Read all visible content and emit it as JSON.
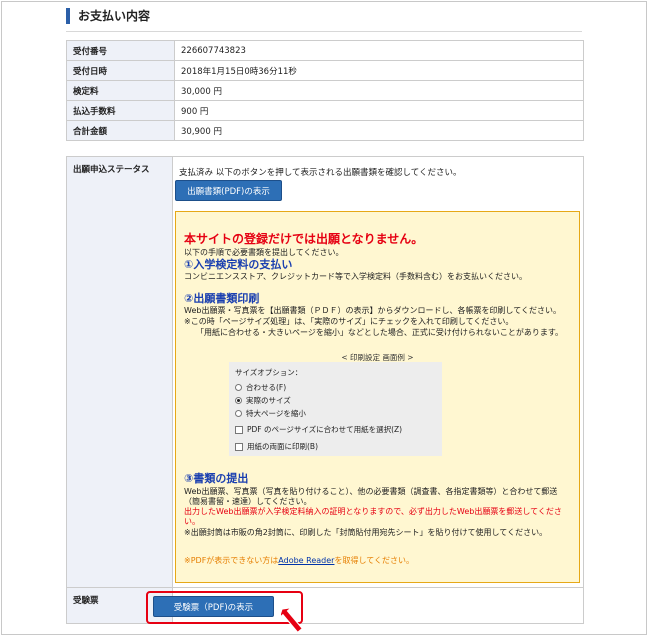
{
  "section": {
    "title": "お支払い内容"
  },
  "summary_rows": [
    {
      "label": "受付番号",
      "value": "226607743823"
    },
    {
      "label": "受付日時",
      "value": "2018年1月15日0時36分11秒"
    },
    {
      "label": "検定料",
      "value": "30,000 円"
    },
    {
      "label": "払込手数料",
      "value": "900 円"
    },
    {
      "label": "合計金額",
      "value": "30,900 円"
    }
  ],
  "status": {
    "label": "出願申込ステータス",
    "description": "支払済み 以下のボタンを押して表示される出願書類を確認してください。",
    "pdf_button": "出願書類(PDF)の表示"
  },
  "notice": {
    "heading": "本サイトの登録だけでは出願となりません。",
    "intro": "以下の手順で必要書類を提出してください。",
    "step1_title": "①入学検定料の支払い",
    "step1_text": "コンビニエンスストア、クレジットカード等で入学検定料（手数料含む）をお支払いください。",
    "step2_title": "②出願書類印刷",
    "step2_line1": "Web出願票・写真票を【出願書類（ＰＤＦ）の表示】からダウンロードし、各帳票を印刷してください。",
    "step2_line2": "※この時「ページサイズ処理」は、「実際のサイズ」にチェックを入れて印刷してください。",
    "step2_line3": "「用紙に合わせる・大きいページを縮小」などとした場合、正式に受け付けられないことがあります。",
    "print_example_caption": "< 印刷設定 画面例 >",
    "print_options": {
      "title": "サイズオプション：",
      "fit": "合わせる(F)",
      "actual": "実際のサイズ",
      "shrink": "特大ページを縮小",
      "choose_paper": "PDF のページサイズに合わせて用紙を選択(Z)",
      "duplex": "用紙の両面に印刷(B)"
    },
    "step3_title": "③書類の提出",
    "step3_line1": "Web出願票、写真票（写真を貼り付けること）、他の必要書類（調査書、各指定書類等）と合わせて郵送",
    "step3_line2": "（簡易書留・速達）してください。",
    "step3_red1": "出力したWeb出願票が入学検定料納入の証明となりますので、必ず出力したWeb出願票を郵送してくださ",
    "step3_red2": "い。",
    "step3_line3": "※出願封筒は市販の角2封筒に、印刷した「封筒貼付用宛先シート」を貼り付けて使用してください。",
    "reader_pre": "※PDFが表示できない方は",
    "reader_link": "Adobe Reader",
    "reader_post": "を取得してください。"
  },
  "exam": {
    "label": "受験票",
    "button": "受験票（PDF)の表示"
  },
  "colors": {
    "accent_red": "#e60012",
    "button_blue": "#2d6fb6",
    "notice_bg": "#fff7d1"
  }
}
